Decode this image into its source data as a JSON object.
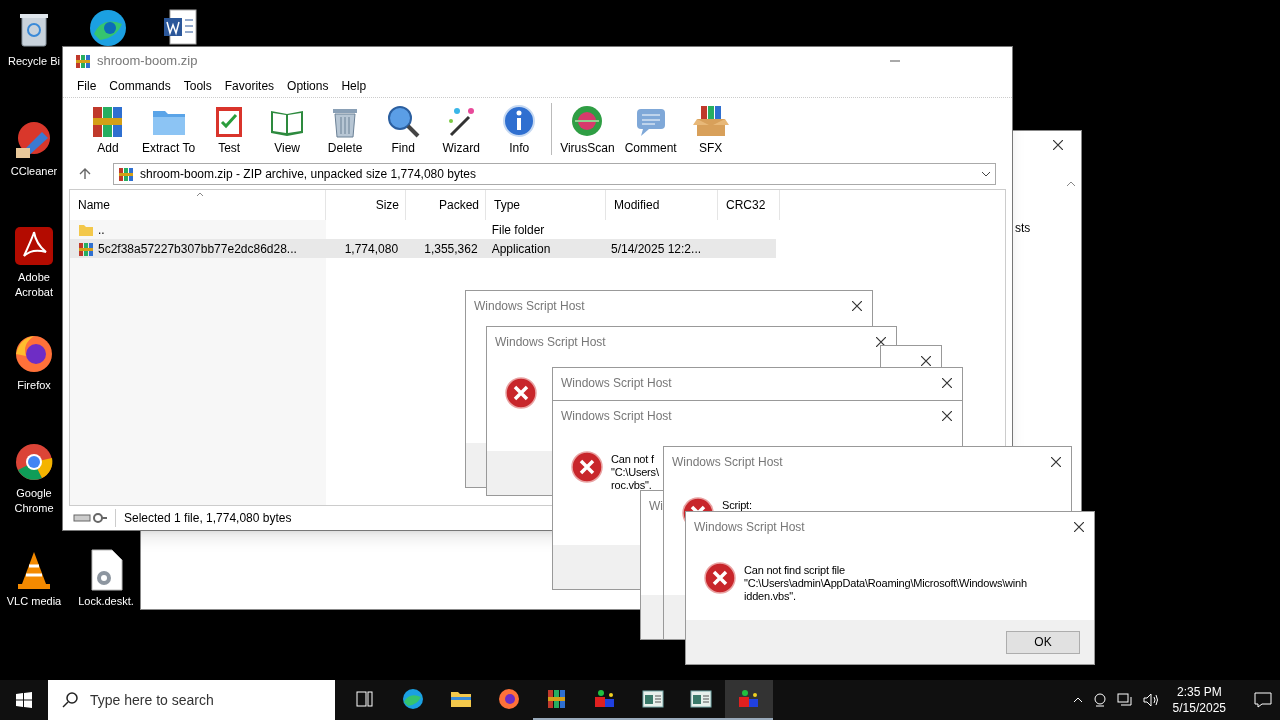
{
  "desktop_icons": [
    {
      "kind": "recycle",
      "label": "Recycle Bi"
    },
    {
      "kind": "edge"
    },
    {
      "kind": "word"
    },
    {
      "kind": "ccleaner",
      "label": "CCleaner"
    },
    {
      "kind": "acrobat",
      "label": "Adobe Acrobat"
    },
    {
      "kind": "firefox",
      "label": "Firefox"
    },
    {
      "kind": "chrome",
      "label": "Google Chrome"
    },
    {
      "kind": "vlc",
      "label": "VLC media"
    },
    {
      "kind": "file",
      "label": "Lock.deskt."
    }
  ],
  "background_window": {
    "text": "sts"
  },
  "winrar": {
    "title": "shroom-boom.zip",
    "menu": [
      "File",
      "Commands",
      "Tools",
      "Favorites",
      "Options",
      "Help"
    ],
    "toolbar": [
      {
        "kind": "add",
        "label": "Add"
      },
      {
        "kind": "extract",
        "label": "Extract To"
      },
      {
        "kind": "test",
        "label": "Test"
      },
      {
        "kind": "view",
        "label": "View"
      },
      {
        "kind": "delete",
        "label": "Delete"
      },
      {
        "kind": "find",
        "label": "Find"
      },
      {
        "kind": "wizard",
        "label": "Wizard"
      },
      {
        "kind": "info",
        "label": "Info"
      },
      {
        "kind": "virusscan",
        "label": "VirusScan"
      },
      {
        "kind": "comment",
        "label": "Comment"
      },
      {
        "kind": "sfx",
        "label": "SFX"
      }
    ],
    "address": "shroom-boom.zip - ZIP archive, unpacked size 1,774,080 bytes",
    "columns": [
      "Name",
      "Size",
      "Packed",
      "Type",
      "Modified",
      "CRC32"
    ],
    "rows": [
      {
        "kind": "folder",
        "cells": [
          "..",
          "",
          "",
          "File folder",
          "",
          ""
        ],
        "selected": false
      },
      {
        "kind": "archive",
        "cells": [
          "5c2f38a57227b307bb77e2dc86d28...",
          "1,774,080",
          "1,355,362",
          "Application",
          "5/14/2025 12:2...",
          ""
        ],
        "selected": true
      }
    ],
    "status": "Selected 1 file, 1,774,080 bytes"
  },
  "dialogs": [
    {
      "title": "Windows Script Host",
      "icon": false
    },
    {
      "title": "Windows Script Host",
      "icon": true
    },
    {
      "icon": false
    },
    {
      "title": "Windows Script Host",
      "icon": false
    },
    {
      "title": "Windows Script Host",
      "icon": true,
      "message": [
        "Can not f",
        "\"C:\\Users\\",
        "roc.vbs\"."
      ]
    },
    {
      "title": "Wi",
      "icon": false
    },
    {
      "title": "Windows Script Host",
      "icon": true,
      "message": [
        "Script:"
      ]
    },
    {
      "title": "Windows Script Host",
      "icon": true,
      "message": [
        "Can not find script file",
        "\"C:\\Users\\admin\\AppData\\Roaming\\Microsoft\\Windows\\winh",
        "idden.vbs\"."
      ],
      "button": "OK"
    }
  ],
  "taskbar": {
    "search_placeholder": "Type here to search",
    "apps": [
      {
        "kind": "taskview",
        "active": false
      },
      {
        "kind": "edge",
        "active": false
      },
      {
        "kind": "explorer",
        "active": false
      },
      {
        "kind": "firefox",
        "active": false
      },
      {
        "kind": "winrar",
        "active": true
      },
      {
        "kind": "app",
        "active": true
      },
      {
        "kind": "window",
        "active": true
      },
      {
        "kind": "window",
        "active": true
      },
      {
        "kind": "app",
        "active": true
      }
    ],
    "time": "2:35 PM",
    "date": "5/15/2025"
  }
}
